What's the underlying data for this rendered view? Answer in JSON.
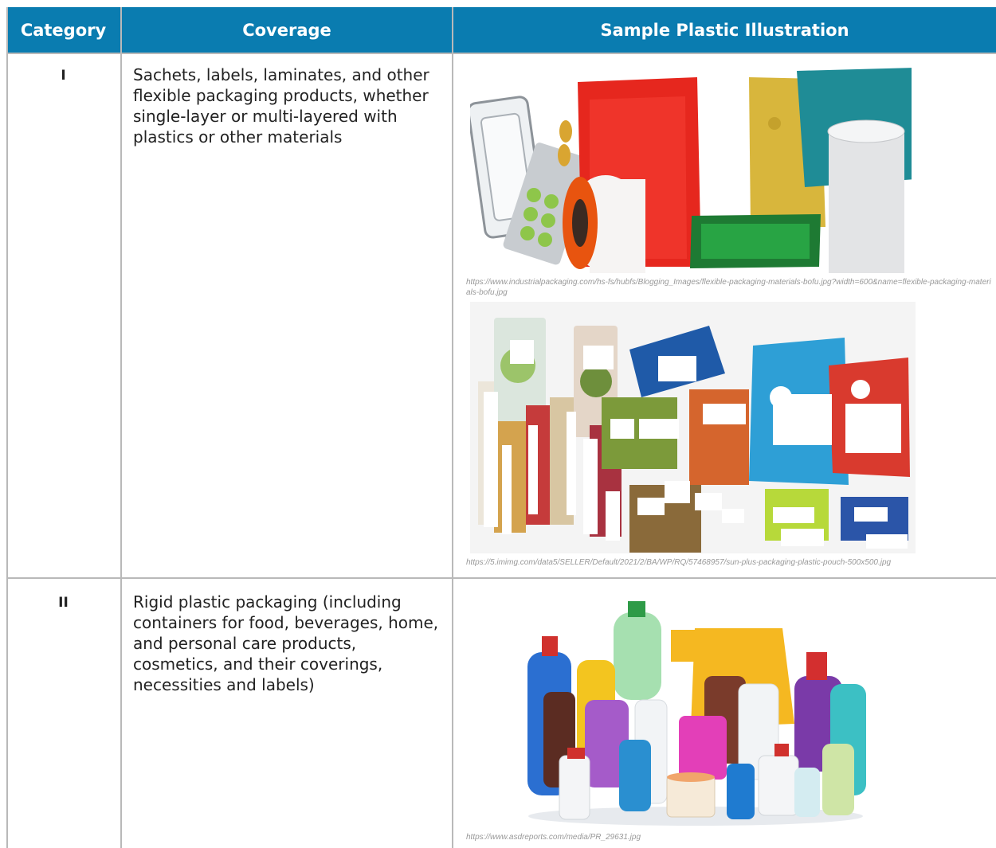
{
  "table": {
    "headers": [
      "Category",
      "Coverage",
      "Sample Plastic Illustration"
    ],
    "rows": [
      {
        "category": "I",
        "coverage": "Sachets, labels, laminates, and other flexible packaging products, whether single-layer or multi-layered with plastics or other materials",
        "images": [
          {
            "icon": "flexible-packaging-photo",
            "source": "https://www.industrialpackaging.com/hs-fs/hubfs/Blogging_Images/flexible-packaging-materials-bofu.jpg?width=600&name=flexible-packaging-materials-bofu.jpg"
          },
          {
            "icon": "plastic-pouches-photo",
            "source": "https://5.imimg.com/data5/SELLER/Default/2021/2/BA/WP/RQ/57468957/sun-plus-packaging-plastic-pouch-500x500.jpg"
          }
        ]
      },
      {
        "category": "II",
        "coverage": "Rigid plastic packaging (including containers for food, beverages, home, and personal care products, cosmetics, and their coverings, necessities and labels)",
        "images": [
          {
            "icon": "rigid-plastic-bottles-photo",
            "source": "https://www.asdreports.com/media/PR_29631.jpg"
          }
        ]
      }
    ]
  },
  "colors": {
    "header_bg": "#0a7cb0",
    "header_text": "#ffffff",
    "grid": "#b9b9b9"
  }
}
